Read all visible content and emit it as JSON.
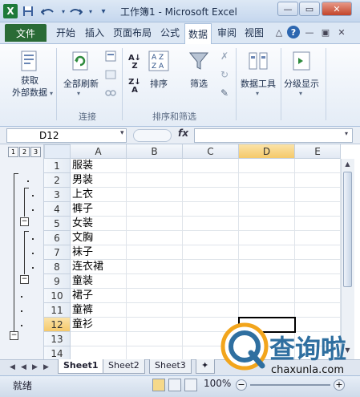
{
  "window": {
    "title": "工作簿1 - Microsoft Excel",
    "app_icon": "X",
    "undo_icon": "undo-icon",
    "redo_icon": "redo-icon"
  },
  "tabs": [
    {
      "label": "文件"
    },
    {
      "label": "开始"
    },
    {
      "label": "插入"
    },
    {
      "label": "页面布局"
    },
    {
      "label": "公式"
    },
    {
      "label": "数据"
    },
    {
      "label": "审阅"
    },
    {
      "label": "视图"
    }
  ],
  "ribbon": {
    "get_external": "获取\n外部数据",
    "refresh_all": "全部刷新",
    "group_connections": "连接",
    "sort": "排序",
    "filter": "筛选",
    "group_sort_filter": "排序和筛选",
    "data_tools": "数据工具",
    "outline": "分级显示"
  },
  "formula_bar": {
    "name_box": "D12",
    "fx": "fx",
    "formula": ""
  },
  "grid": {
    "columns": [
      "A",
      "B",
      "C",
      "D",
      "E"
    ],
    "selected_column": "D",
    "selected_row": "12",
    "outline_levels": [
      "1",
      "2",
      "3"
    ],
    "rows": [
      {
        "num": "1",
        "a": "服装"
      },
      {
        "num": "2",
        "a": "男装"
      },
      {
        "num": "3",
        "a": "上衣"
      },
      {
        "num": "4",
        "a": "裤子"
      },
      {
        "num": "5",
        "a": "女装"
      },
      {
        "num": "6",
        "a": "文胸"
      },
      {
        "num": "7",
        "a": "袜子"
      },
      {
        "num": "8",
        "a": "连衣裙"
      },
      {
        "num": "9",
        "a": "童装"
      },
      {
        "num": "10",
        "a": "裙子"
      },
      {
        "num": "11",
        "a": "童裤"
      },
      {
        "num": "12",
        "a": "童衫"
      },
      {
        "num": "13",
        "a": ""
      },
      {
        "num": "14",
        "a": ""
      }
    ]
  },
  "sheets": [
    "Sheet1",
    "Sheet2",
    "Sheet3"
  ],
  "status": {
    "ready": "就绪",
    "zoom": "100%"
  },
  "watermark": {
    "text": "查询啦",
    "sub": "chaxunla.com"
  },
  "colors": {
    "file_tab": "#2a6b36",
    "selected_header": "#f8d68a",
    "watermark_blue": "#2f6fa0"
  }
}
